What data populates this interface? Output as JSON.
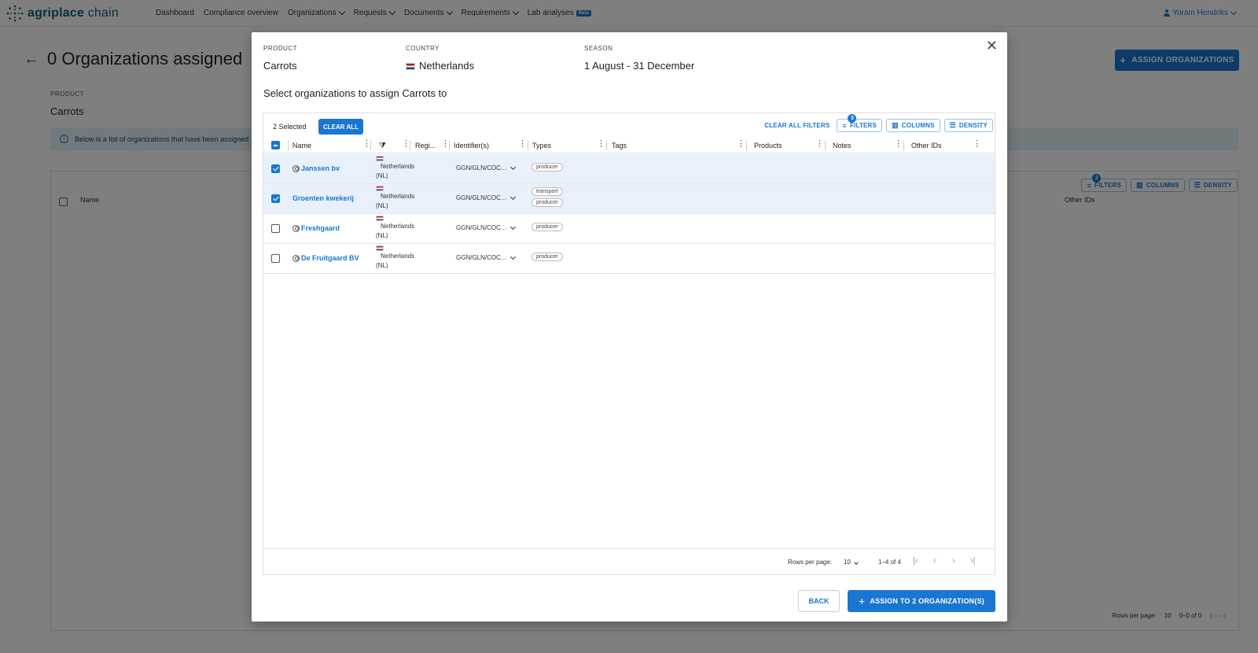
{
  "nav": {
    "logo_bold": "agriplace",
    "logo_light": " chain",
    "items": [
      {
        "label": "Dashboard",
        "dropdown": false
      },
      {
        "label": "Compliance overview",
        "dropdown": false
      },
      {
        "label": "Organizations",
        "dropdown": true
      },
      {
        "label": "Requests",
        "dropdown": true
      },
      {
        "label": "Documents",
        "dropdown": true
      },
      {
        "label": "Requirements",
        "dropdown": true
      },
      {
        "label": "Lab analyses",
        "dropdown": false,
        "badge": "Beta"
      }
    ],
    "user": "Yoram Hendriks"
  },
  "background": {
    "title": "0 Organizations assigned",
    "assign_button": "ASSIGN ORGANIZATIONS",
    "product_label": "PRODUCT",
    "product_value": "Carrots",
    "info_text": "Below is a list of organizations that have been assigned",
    "filter_badge": "2",
    "filters_label": "FILTERS",
    "columns_label": "COLUMNS",
    "density_label": "DENSITY",
    "name_header": "Name",
    "other_ids_header": "Other IDs",
    "rows_per_page_label": "Rows per page:",
    "rows_per_page_value": "10",
    "range": "0–0 of 0"
  },
  "modal": {
    "product_label": "PRODUCT",
    "product_value": "Carrots",
    "country_label": "COUNTRY",
    "country_value": "Netherlands",
    "season_label": "SEASON",
    "season_value": "1 August - 31 December",
    "subheading": "Select organizations to assign Carrots to",
    "selected_count": "2 Selected",
    "clear_all": "CLEAR ALL",
    "clear_all_filters": "CLEAR ALL FILTERS",
    "filters_label": "FILTERS",
    "filter_badge": "3",
    "columns_label": "COLUMNS",
    "density_label": "DENSITY",
    "columns": {
      "name": "Name",
      "region": "Regi...",
      "identifiers": "Identifier(s)",
      "types": "Types",
      "tags": "Tags",
      "products": "Products",
      "notes": "Notes",
      "other_ids": "Other IDs"
    },
    "rows": [
      {
        "name": "Janssen bv",
        "icon": true,
        "country": "Netherlands",
        "country_code": "(NL)",
        "identifier": "GGN/GLN/COC...",
        "types": [
          "producer"
        ],
        "selected": true
      },
      {
        "name": "Groenten kwekerij",
        "icon": false,
        "country": "Netherlands",
        "country_code": "(NL)",
        "identifier": "GGN/GLN/COC...",
        "types": [
          "transport",
          "producer"
        ],
        "selected": true
      },
      {
        "name": "Freshgaard",
        "icon": true,
        "country": "Netherlands",
        "country_code": "(NL)",
        "identifier": "GGN/GLN/COC...",
        "types": [
          "producer"
        ],
        "selected": false
      },
      {
        "name": "De Fruitgaard BV",
        "icon": true,
        "country": "Netherlands",
        "country_code": "(NL)",
        "identifier": "GGN/GLN/COC...",
        "types": [
          "producer"
        ],
        "selected": false
      }
    ],
    "rows_per_page_label": "Rows per page:",
    "rows_per_page_value": "10",
    "range": "1–4 of 4",
    "back_button": "BACK",
    "assign_button": "ASSIGN TO 2 ORGANIZATION(S)"
  },
  "icons": {
    "close": "close-icon",
    "back": "arrow-left-icon",
    "info": "info-icon",
    "plus": "plus-icon",
    "filter": "filter-icon"
  }
}
